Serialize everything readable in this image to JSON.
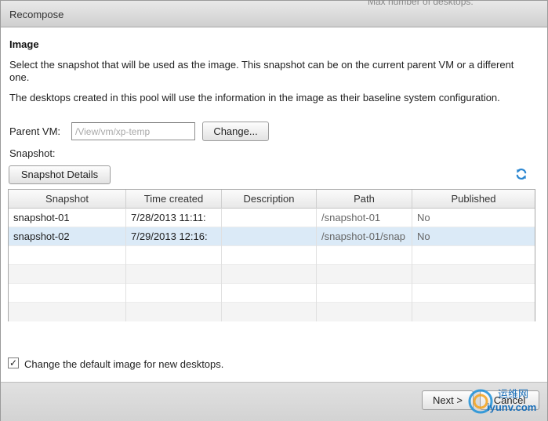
{
  "window": {
    "title": "Recompose",
    "background_text": "Max number of desktops:"
  },
  "image_section": {
    "title": "Image",
    "description_1": "Select the snapshot that will be used as the image. This snapshot can be on the current parent VM or a different one.",
    "description_2": "The desktops created in this pool will use the information in the image as their baseline system configuration.",
    "parent_vm_label": "Parent VM:",
    "parent_vm_value": "/View/vm/xp-temp",
    "change_button": "Change...",
    "snapshot_label": "Snapshot:",
    "snapshot_details_button": "Snapshot Details",
    "refresh_icon": "refresh-icon"
  },
  "table": {
    "columns": [
      "Snapshot",
      "Time created",
      "Description",
      "Path",
      "Published"
    ],
    "rows": [
      {
        "snapshot": "snapshot-01",
        "time_created": "7/28/2013 11:11:",
        "description": "",
        "path": "/snapshot-01",
        "published": "No"
      },
      {
        "snapshot": "snapshot-02",
        "time_created": "7/29/2013 12:16:",
        "description": "",
        "path": "/snapshot-01/snap",
        "published": "No"
      }
    ],
    "selected_row": 1
  },
  "options": {
    "change_default_image_checked": true,
    "change_default_image_label": "Change the default image for new desktops."
  },
  "footer": {
    "next_button": "Next >",
    "cancel_button": "Cancel"
  },
  "watermark": {
    "line1": "运维网",
    "line2": "iyunv.com"
  },
  "colors": {
    "selected_row": "#dbeaf7",
    "refresh_icon": "#2a86d1"
  }
}
